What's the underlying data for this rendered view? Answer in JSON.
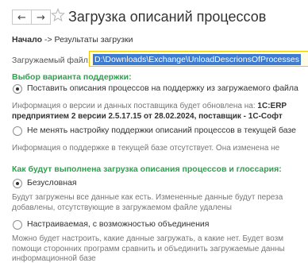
{
  "header": {
    "back_glyph": "←",
    "forward_glyph": "→",
    "favorite_icon": "star-icon",
    "title": "Загрузка описаний процессов"
  },
  "breadcrumb": {
    "start": "Начало",
    "separator": "->",
    "current": "Результаты загрузки"
  },
  "file_field": {
    "label": "Загружаемый файл:",
    "value": "D:\\Downloads\\Exchange\\UnloadDescrionsOfProcesses"
  },
  "support_section": {
    "title": "Выбор варианта поддержки:",
    "options": [
      {
        "label": "Поставить описания процессов на поддержку из загружаемого файла",
        "selected": true,
        "info_line1_normal": "Информация о версии и данных поставщика будет обновлена на: ",
        "info_line1_bold": "1С:ERP",
        "info_line2_bold": "предприятием 2 версии 2.5.17.15 от 28.02.2024, поставщик - 1С-Софт"
      },
      {
        "label": "Не менять настройку поддержки описаний процессов в текущей базе",
        "selected": false,
        "info": "Информация о поддержке в текущей базе отсутствует. Она изменена не"
      }
    ]
  },
  "load_section": {
    "title": "Как будут выполнена загрузка описания процессов и глоссария:",
    "options": [
      {
        "label": "Безусловная",
        "selected": true,
        "info_line1": "Будут загружены все данные как есть. Измененные данные будут переза",
        "info_line2": "добавлены, отсутствующие в загружаемом файле удалены"
      },
      {
        "label": "Настраиваемая, с возможностью объединения",
        "selected": false,
        "info_line1": "Можно будет настроить, какие данные загружать, а какие нет. Будет возм",
        "info_line2": "помощи сторонних программ сравнить и объединить загружаемые данны",
        "info_line3": "информационной базе"
      }
    ]
  },
  "colors": {
    "section_title": "#2ba24c",
    "field_border": "#f1c500",
    "field_background": "#fffbe5",
    "selection": "#3d7cd1"
  }
}
